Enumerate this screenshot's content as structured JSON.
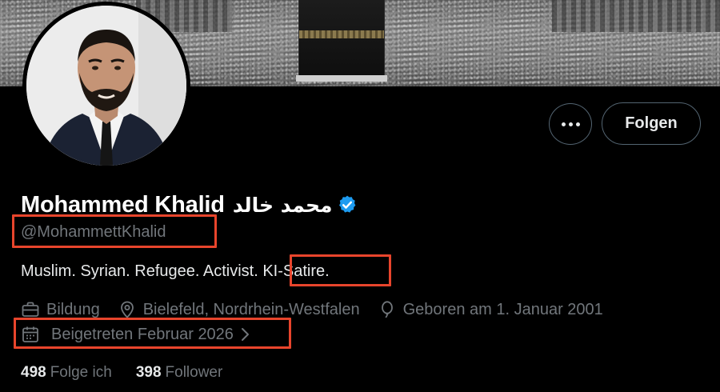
{
  "profile": {
    "display_name": "Mohammed Khalid",
    "arabic_name": "محمد خالد",
    "verified_icon": "verified-badge-icon",
    "handle": "@MohammettKhalid",
    "bio": "Muslim. Syrian. Refugee. Activist. KI-Satire.",
    "avatar_alt": "avatar"
  },
  "actions": {
    "more_icon": "more-horizontal-icon",
    "follow_label": "Folgen"
  },
  "meta": {
    "profession": "Bildung",
    "location": "Bielefeld, Nordrhein-Westfalen",
    "birthday": "Geboren am 1. Januar 2001",
    "joined": "Beigetreten Februar 2026"
  },
  "stats": {
    "following_count": "498",
    "following_label": "Folge ich",
    "followers_count": "398",
    "followers_label": "Follower"
  },
  "colors": {
    "background": "#000000",
    "text_primary": "#e7e9ea",
    "text_secondary": "#71767b",
    "verified": "#1d9bf0",
    "annotation": "#e8452c",
    "button_border": "#536471"
  }
}
